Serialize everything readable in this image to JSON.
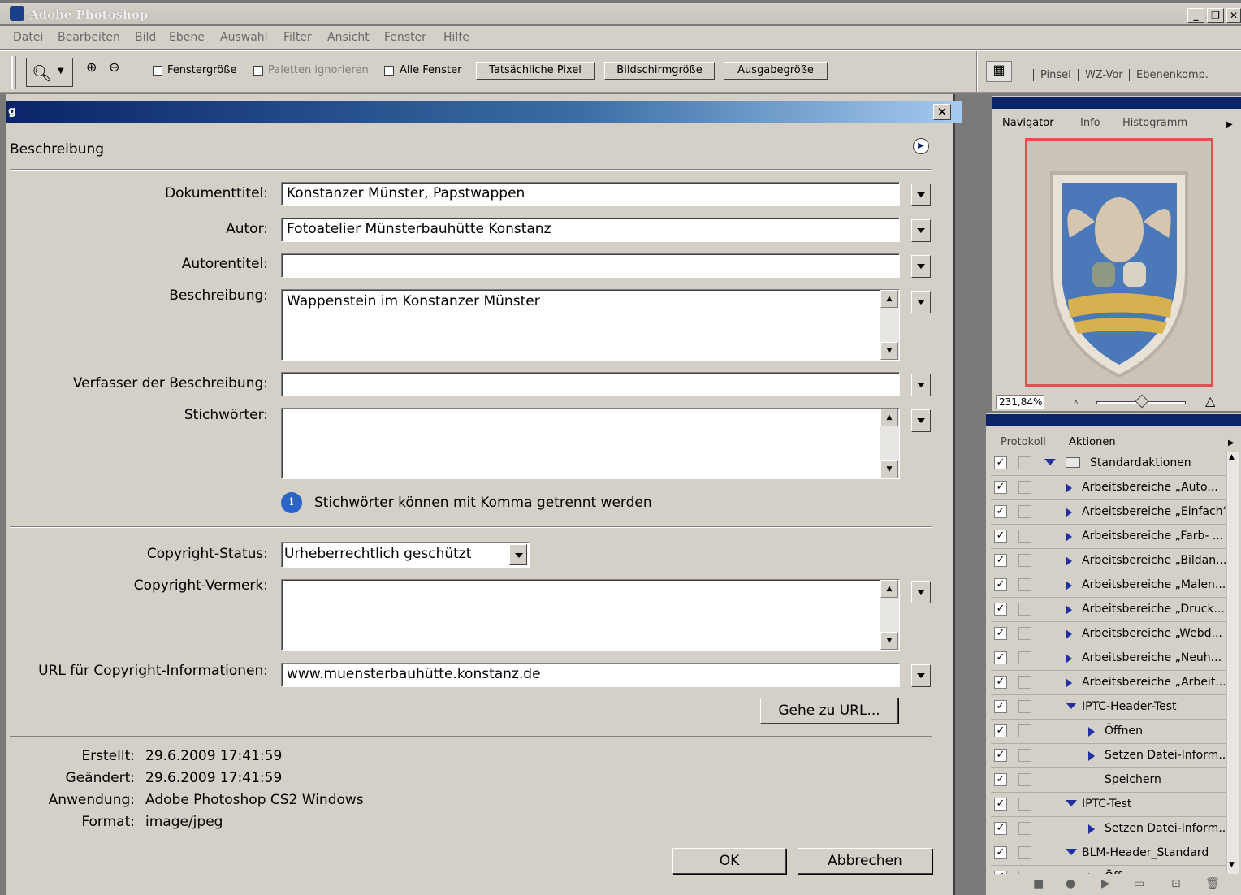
{
  "app": {
    "title": "Adobe Photoshop",
    "menu": [
      "Datei",
      "Bearbeiten",
      "Bild",
      "Ebene",
      "Auswahl",
      "Filter",
      "Ansicht",
      "Fenster",
      "Hilfe"
    ]
  },
  "toolbar": {
    "fenstergroesse": "Fenstergröße",
    "paletten": "Paletten ignorieren",
    "alle_fenster": "Alle Fenster",
    "tatsaechliche": "Tatsächliche Pixel",
    "bildschirm": "Bildschirmgröße",
    "ausgabe": "Ausgabegröße",
    "well_tabs": [
      "Pinsel",
      "WZ-Vor",
      "Ebenenkomp."
    ]
  },
  "dialog": {
    "title_fragment": "g",
    "section": "Beschreibung",
    "labels": {
      "dokumenttitel": "Dokumenttitel:",
      "autor": "Autor:",
      "autorentitel": "Autorentitel:",
      "beschreibung": "Beschreibung:",
      "verfasser": "Verfasser der Beschreibung:",
      "stichwoerter": "Stichwörter:",
      "copyright_status": "Copyright-Status:",
      "copyright_vermerk": "Copyright-Vermerk:",
      "url": "URL für Copyright-Informationen:"
    },
    "values": {
      "dokumenttitel": "Konstanzer Münster, Papstwappen",
      "autor": "Fotoatelier Münsterbauhütte Konstanz",
      "autorentitel": "",
      "beschreibung": "Wappenstein im Konstanzer Münster",
      "verfasser": "",
      "stichwoerter": "",
      "copyright_status": "Urheberrechtlich geschützt",
      "copyright_vermerk": "",
      "url": "www.muensterbauhütte.konstanz.de"
    },
    "hint": "Stichwörter können mit Komma getrennt werden",
    "goto_url": "Gehe zu URL...",
    "meta": {
      "erstellt_label": "Erstellt:",
      "erstellt": "29.6.2009 17:41:59",
      "geaendert_label": "Geändert:",
      "geaendert": "29.6.2009 17:41:59",
      "anwendung_label": "Anwendung:",
      "anwendung": "Adobe Photoshop CS2 Windows",
      "format_label": "Format:",
      "format": "image/jpeg"
    },
    "ok": "OK",
    "cancel": "Abbrechen"
  },
  "navigator": {
    "tabs": [
      "Navigator",
      "Info",
      "Histogramm"
    ],
    "zoom": "231,84%",
    "zoom_fraction": 0.55
  },
  "actions": {
    "tabs": [
      "Protokoll",
      "Aktionen"
    ],
    "items": [
      {
        "label": "Standardaktionen",
        "level": 0,
        "type": "folder"
      },
      {
        "label": "Arbeitsbereiche „Auto...",
        "level": 1,
        "type": "closed"
      },
      {
        "label": "Arbeitsbereiche „Einfach“",
        "level": 1,
        "type": "closed"
      },
      {
        "label": "Arbeitsbereiche „Farb- ...",
        "level": 1,
        "type": "closed"
      },
      {
        "label": "Arbeitsbereiche „Bildan...",
        "level": 1,
        "type": "closed"
      },
      {
        "label": "Arbeitsbereiche „Malen...",
        "level": 1,
        "type": "closed"
      },
      {
        "label": "Arbeitsbereiche „Druck...",
        "level": 1,
        "type": "closed"
      },
      {
        "label": "Arbeitsbereiche „Webd...",
        "level": 1,
        "type": "closed"
      },
      {
        "label": "Arbeitsbereiche „Neuh...",
        "level": 1,
        "type": "closed"
      },
      {
        "label": "Arbeitsbereiche „Arbeit...",
        "level": 1,
        "type": "closed"
      },
      {
        "label": "IPTC-Header-Test",
        "level": 1,
        "type": "open"
      },
      {
        "label": "Öffnen",
        "level": 2,
        "type": "closed"
      },
      {
        "label": "Setzen Datei-Inform...",
        "level": 2,
        "type": "closed"
      },
      {
        "label": "Speichern",
        "level": 2,
        "type": "none"
      },
      {
        "label": "IPTC-Test",
        "level": 1,
        "type": "open"
      },
      {
        "label": "Setzen Datei-Inform...",
        "level": 2,
        "type": "closed"
      },
      {
        "label": "BLM-Header_Standard",
        "level": 1,
        "type": "open"
      },
      {
        "label": "Öff...",
        "level": 2,
        "type": "closed"
      }
    ]
  }
}
